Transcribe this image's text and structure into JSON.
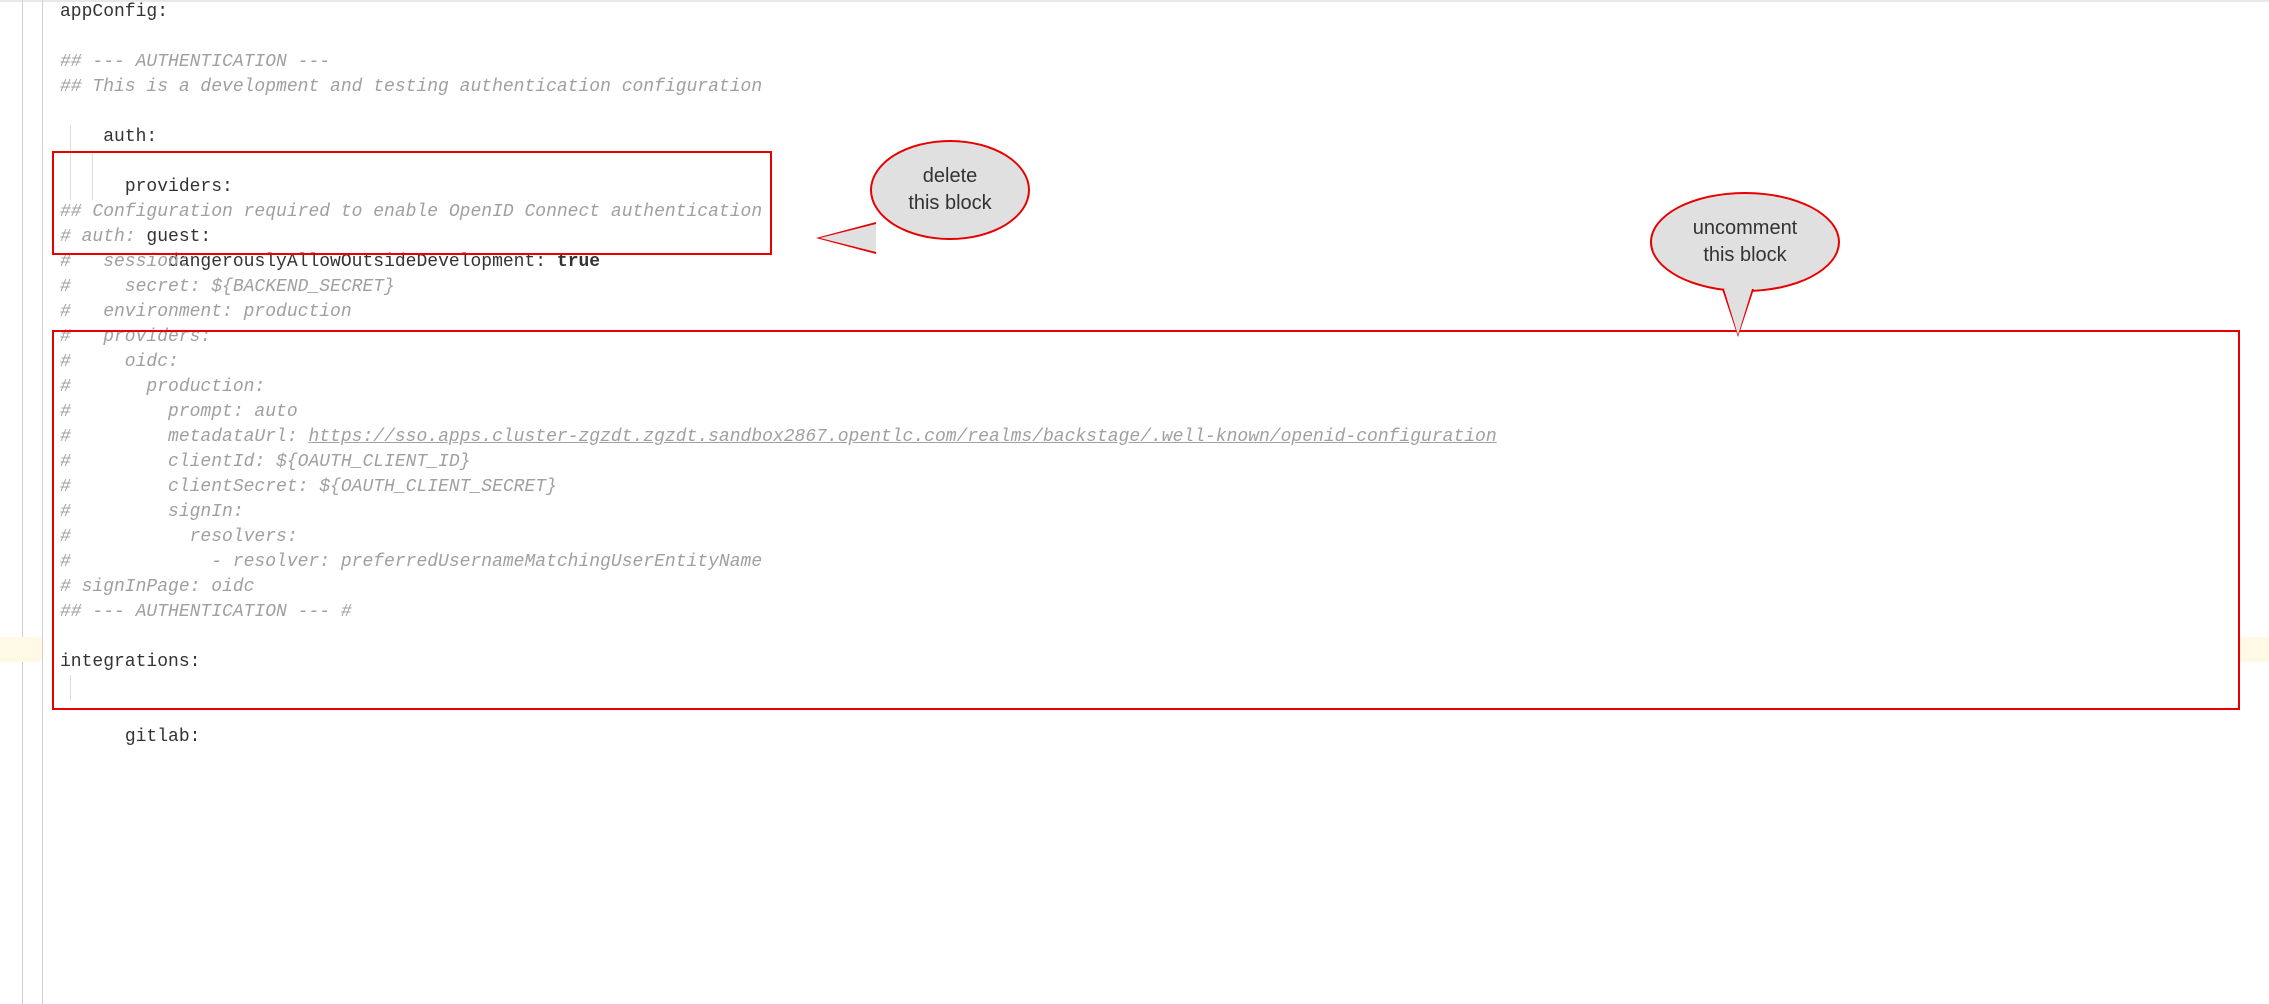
{
  "lines": {
    "l0": "appConfig:",
    "l1": "",
    "l2": "## --- AUTHENTICATION ---",
    "l3": "## This is a development and testing authentication configuration",
    "l4": "auth:",
    "l5": "  providers:",
    "l6": "    guest:",
    "l7a": "      dangerouslyAllowOutsideDevelopment: ",
    "l7b": "true",
    "l8": "## Configuration required to enable OpenID Connect authentication",
    "l9": "# auth:",
    "l10": "#   session:",
    "l11": "#     secret: ${BACKEND_SECRET}",
    "l12": "#   environment: production",
    "l13": "#   providers:",
    "l14": "#     oidc:",
    "l15": "#       production:",
    "l16": "#         prompt: auto",
    "l17a": "#         metadataUrl: ",
    "l17b": "https://sso.apps.cluster-zgzdt.zgzdt.sandbox2867.opentlc.com/realms/backstage/.well-known/openid-configuration",
    "l18": "#         clientId: ${OAUTH_CLIENT_ID}",
    "l19": "#         clientSecret: ${OAUTH_CLIENT_SECRET}",
    "l20": "#         signIn:",
    "l21": "#           resolvers:",
    "l22": "#             - resolver: preferredUsernameMatchingUserEntityName",
    "l23": "# signInPage: oidc",
    "l24": "## --- AUTHENTICATION --- #",
    "l25": "",
    "l26": "integrations:",
    "l27": "  gitlab:"
  },
  "callouts": {
    "delete_l1": "delete",
    "delete_l2": "this block",
    "uncomment_l1": "uncomment",
    "uncomment_l2": "this block"
  }
}
